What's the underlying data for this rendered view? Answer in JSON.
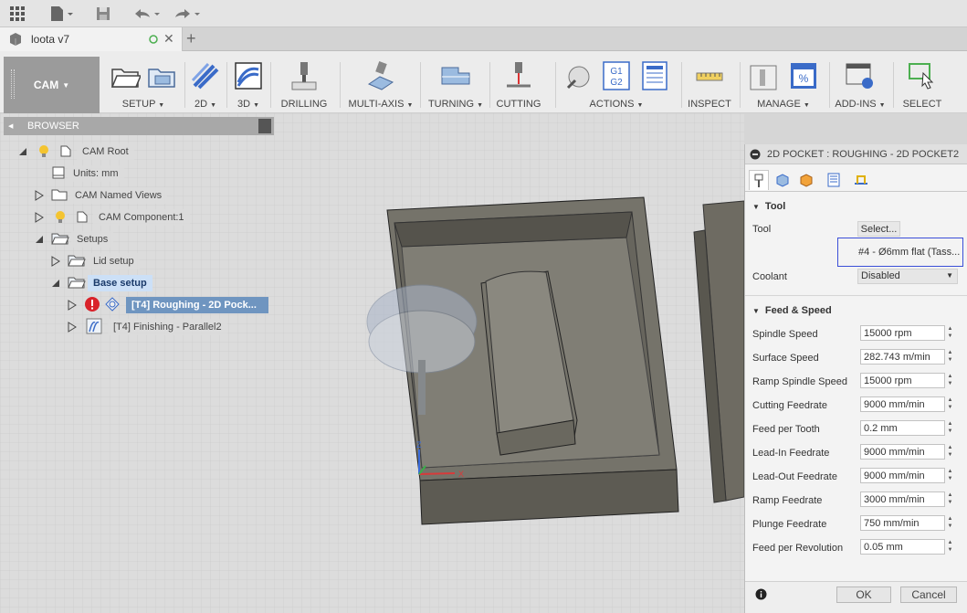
{
  "document": {
    "tab_title": "loota v7"
  },
  "toolbar": {
    "workspace": "CAM",
    "groups": [
      {
        "label": "SETUP",
        "dropdown": true
      },
      {
        "label": "2D",
        "dropdown": true
      },
      {
        "label": "3D",
        "dropdown": true
      },
      {
        "label": "DRILLING",
        "dropdown": false
      },
      {
        "label": "MULTI-AXIS",
        "dropdown": true
      },
      {
        "label": "TURNING",
        "dropdown": true
      },
      {
        "label": "CUTTING",
        "dropdown": false
      },
      {
        "label": "ACTIONS",
        "dropdown": true
      },
      {
        "label": "INSPECT",
        "dropdown": false
      },
      {
        "label": "MANAGE",
        "dropdown": true
      },
      {
        "label": "ADD-INS",
        "dropdown": true
      },
      {
        "label": "SELECT",
        "dropdown": false
      }
    ],
    "actions_icon_text": [
      "G1",
      "G2"
    ],
    "manage_icon_text": "%"
  },
  "browser": {
    "title": "BROWSER",
    "items": [
      {
        "label": "CAM Root"
      },
      {
        "label": "Units: mm"
      },
      {
        "label": "CAM Named Views"
      },
      {
        "label": "CAM Component:1"
      },
      {
        "label": "Setups"
      },
      {
        "label": "Lid setup"
      },
      {
        "label": "Base setup"
      },
      {
        "label": "[T4] Roughing - 2D Pock..."
      },
      {
        "label": "[T4] Finishing - Parallel2"
      }
    ]
  },
  "panel": {
    "title": "2D POCKET : ROUGHING - 2D POCKET2",
    "tool_section": "Tool",
    "tool_label": "Tool",
    "tool_select": "Select...",
    "tool_name": "#4 - Ø6mm flat (Tass...",
    "coolant_label": "Coolant",
    "coolant_value": "Disabled",
    "feed_section": "Feed & Speed",
    "fields": [
      {
        "label": "Spindle Speed",
        "value": "15000 rpm"
      },
      {
        "label": "Surface Speed",
        "value": "282.743 m/min"
      },
      {
        "label": "Ramp Spindle Speed",
        "value": "15000 rpm"
      },
      {
        "label": "Cutting Feedrate",
        "value": "9000 mm/min"
      },
      {
        "label": "Feed per Tooth",
        "value": "0.2 mm"
      },
      {
        "label": "Lead-In Feedrate",
        "value": "9000 mm/min"
      },
      {
        "label": "Lead-Out Feedrate",
        "value": "9000 mm/min"
      },
      {
        "label": "Ramp Feedrate",
        "value": "3000 mm/min"
      },
      {
        "label": "Plunge Feedrate",
        "value": "750 mm/min"
      },
      {
        "label": "Feed per Revolution",
        "value": "0.05 mm"
      }
    ],
    "ok": "OK",
    "cancel": "Cancel"
  },
  "axes": {
    "x": "X",
    "z": "Z"
  }
}
